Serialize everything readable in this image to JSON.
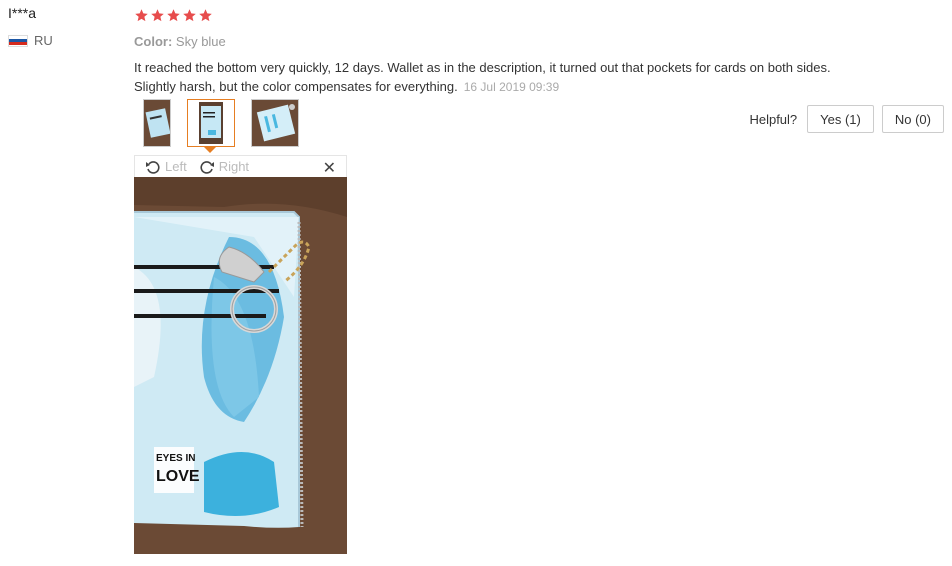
{
  "reviewer": {
    "name": "I***a",
    "country": "RU",
    "flag_colors": [
      "#ffffff",
      "#1c57a5",
      "#d52b1e"
    ]
  },
  "review": {
    "rating": 5,
    "star_color": "#e74c4c",
    "color_label": "Color:",
    "color_value": "Sky blue",
    "text": "It reached the bottom very quickly, 12 days. Wallet as in the description, it turned out that pockets for cards on both sides. Slightly harsh, but the color compensates for everything.",
    "date": "16 Jul 2019 09:39"
  },
  "thumbnails": {
    "count": 3,
    "active_index": 1,
    "accent_color": "#e67e22"
  },
  "helpful": {
    "label": "Helpful?",
    "yes_label": "Yes (1)",
    "no_label": "No (0)"
  },
  "viewer": {
    "rotate_left_label": "Left",
    "rotate_right_label": "Right",
    "close_glyph": "✕",
    "print_text_line1": "EYES IN",
    "print_text_line2": "LOVE"
  }
}
